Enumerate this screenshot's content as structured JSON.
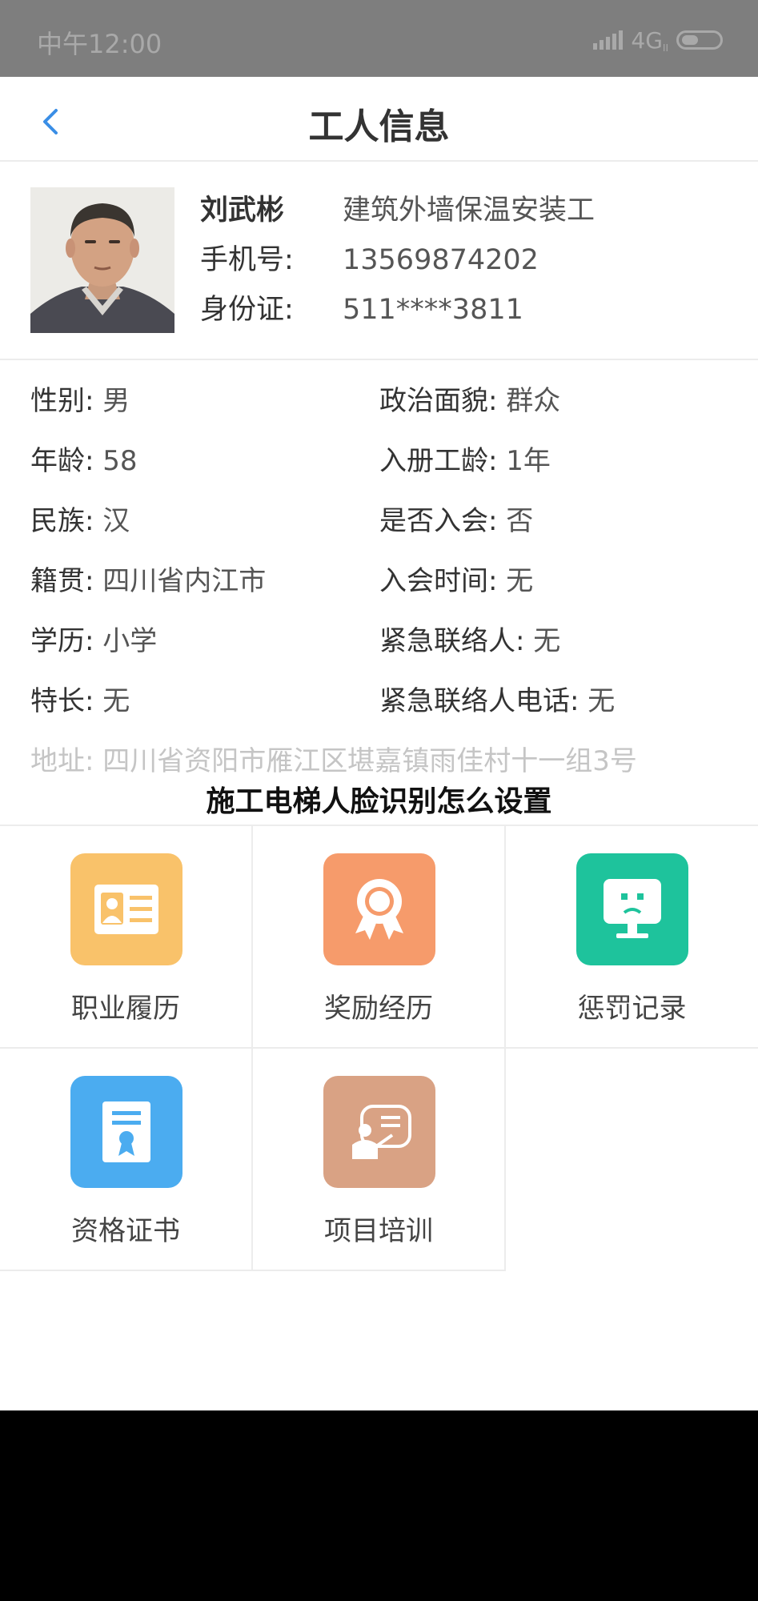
{
  "status_bar": {
    "time": "中午12:00",
    "network": "4G",
    "network_sub": "II"
  },
  "nav": {
    "title": "工人信息"
  },
  "profile": {
    "name": "刘武彬",
    "job": "建筑外墙保温安装工",
    "phone_label": "手机号:",
    "phone": "13569874202",
    "id_label": "身份证:",
    "id_number": "511****3811"
  },
  "details": {
    "left": [
      {
        "label": "性别:",
        "value": "男"
      },
      {
        "label": "年龄:",
        "value": "58"
      },
      {
        "label": "民族:",
        "value": "汉"
      },
      {
        "label": "籍贯:",
        "value": "四川省内江市"
      },
      {
        "label": "学历:",
        "value": "小学"
      },
      {
        "label": "特长:",
        "value": "无"
      }
    ],
    "right": [
      {
        "label": "政治面貌:",
        "value": "群众"
      },
      {
        "label": "入册工龄:",
        "value": "1年"
      },
      {
        "label": "是否入会:",
        "value": "否"
      },
      {
        "label": "入会时间:",
        "value": "无"
      },
      {
        "label": "紧急联络人:",
        "value": "无"
      },
      {
        "label": "紧急联络人电话:",
        "value": "无"
      }
    ],
    "address": {
      "label": "地址:",
      "value": "四川省资阳市雁江区堪嘉镇雨佳村十一组3号"
    }
  },
  "overlay_caption": "施工电梯人脸识别怎么设置",
  "menu": [
    {
      "label": "职业履历",
      "icon": "id-card-icon",
      "color": "#f9c26a"
    },
    {
      "label": "奖励经历",
      "icon": "award-icon",
      "color": "#f69b6b"
    },
    {
      "label": "惩罚记录",
      "icon": "monitor-icon",
      "color": "#1ec39c"
    },
    {
      "label": "资格证书",
      "icon": "certificate-icon",
      "color": "#4bacf0"
    },
    {
      "label": "项目培训",
      "icon": "training-icon",
      "color": "#d9a284"
    }
  ],
  "colors": {
    "accent": "#3a8ee6",
    "status_bar": "#7e7e7e"
  }
}
